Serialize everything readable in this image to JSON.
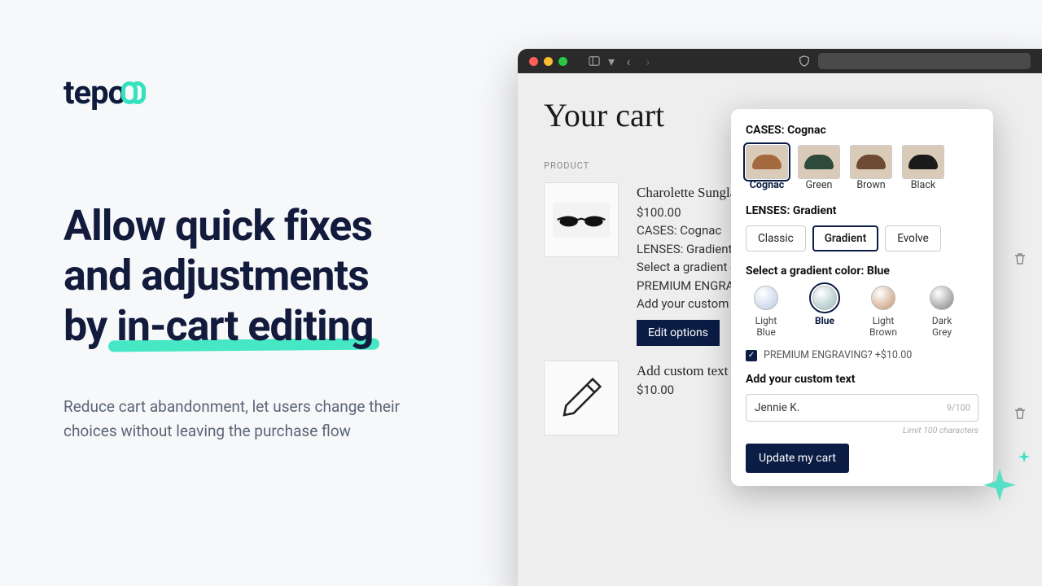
{
  "brand": {
    "name": "tepo"
  },
  "hero": {
    "line1": "Allow quick fixes",
    "line2": "and adjustments",
    "line3_prefix": "by ",
    "line3_highlight": "in-cart editing",
    "sub": "Reduce cart abandonment, let users change their choices without leaving the purchase flow"
  },
  "cart": {
    "title": "Your cart",
    "col_product": "PRODUCT",
    "items": [
      {
        "name": "Charolette Sunglasses",
        "price": "$100.00",
        "opt_cases": "CASES: Cognac",
        "opt_lenses": "LENSES: Gradient",
        "opt_gradient": "Select a gradient color: Blue",
        "opt_engraving": "PREMIUM ENGRAVING?: Yes",
        "opt_custom": "Add your custom text: Jennie K.",
        "edit_label": "Edit options"
      },
      {
        "name": "Add custom text",
        "price": "$10.00"
      }
    ]
  },
  "popover": {
    "cases_label": "CASES: Cognac",
    "cases": [
      {
        "label": "Cognac",
        "color": "#a46a3f",
        "selected": true
      },
      {
        "label": "Green",
        "color": "#2e4a3a"
      },
      {
        "label": "Brown",
        "color": "#6e4a32"
      },
      {
        "label": "Black",
        "color": "#1a1a1a"
      }
    ],
    "lenses_label": "LENSES: Gradient",
    "lenses": [
      {
        "label": "Classic"
      },
      {
        "label": "Gradient",
        "selected": true
      },
      {
        "label": "Evolve"
      }
    ],
    "gradient_label": "Select a gradient color: Blue",
    "colors": [
      {
        "label": "Light Blue",
        "color": "#b9c9e4"
      },
      {
        "label": "Blue",
        "color": "#97bcb9",
        "selected": true
      },
      {
        "label": "Light Brown",
        "color": "#c6926a"
      },
      {
        "label": "Dark Grey",
        "color": "#7b7f82"
      }
    ],
    "engraving_label": "PREMIUM ENGRAVING? +$10.00",
    "engraving_checked": true,
    "custom_label": "Add your custom text",
    "custom_value": "Jennie K.",
    "custom_counter": "9/100",
    "custom_limit": "Limit 100 characters",
    "update_label": "Update my cart"
  }
}
